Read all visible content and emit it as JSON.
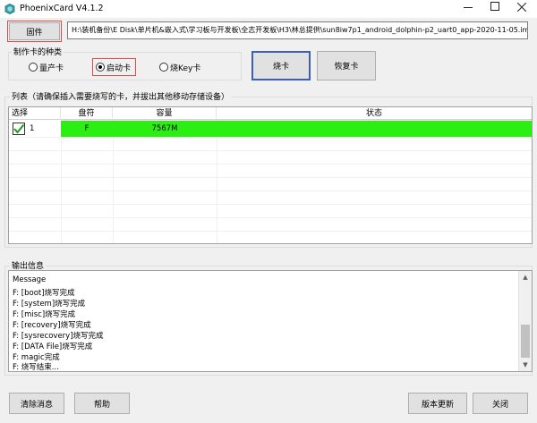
{
  "window": {
    "title": "PhoenixCard V4.1.2"
  },
  "toolbar": {
    "firmware_label": "固件",
    "image_path": "H:\\装机备份\\E Disk\\单片机&嵌入式\\学习板与开发板\\全志开发板\\H3\\林总提供\\sun8iw7p1_android_dolphin-p2_uart0_app-2020-11-05.img"
  },
  "card_type": {
    "title": "制作卡的种类",
    "options": [
      {
        "label": "量产卡",
        "checked": false
      },
      {
        "label": "启动卡",
        "checked": true
      },
      {
        "label": "烧Key卡",
        "checked": false
      }
    ]
  },
  "actions": {
    "burn_label": "烧卡",
    "restore_label": "恢复卡"
  },
  "list": {
    "title": "列表（请确保插入需要烧写的卡，并拔出其他移动存储设备）",
    "columns": [
      "选择",
      "盘符",
      "容量",
      "状态"
    ],
    "rows": [
      {
        "index": "1",
        "checked": true,
        "drive": "F",
        "capacity": "7567M",
        "status": ""
      }
    ]
  },
  "output": {
    "title": "输出信息",
    "lines": [
      "Message",
      "F: [boot]烧写完成",
      "F: [system]烧写完成",
      "F: [misc]烧写完成",
      "F: [recovery]烧写完成",
      "F: [sysrecovery]烧写完成",
      "F: [DATA File]烧写完成",
      "F: magic完成",
      "F: 烧写结束..."
    ]
  },
  "footer": {
    "clear_label": "清除消息",
    "help_label": "帮助",
    "update_label": "版本更新",
    "close_label": "关闭"
  },
  "colors": {
    "status_ok": "#2bef13",
    "highlight_border": "#e34848",
    "focus_border": "#3c5fb4"
  }
}
